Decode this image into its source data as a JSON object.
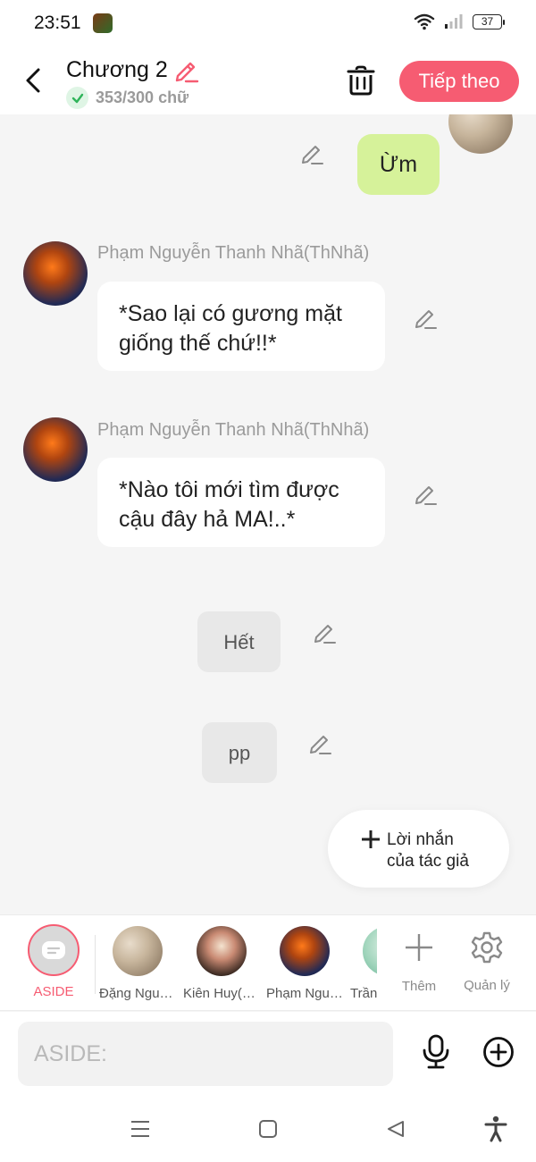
{
  "status_bar": {
    "time": "23:51",
    "battery": "37"
  },
  "header": {
    "title": "Chương 2",
    "word_count": "353/300 chữ",
    "next_button": "Tiếp theo"
  },
  "messages": [
    {
      "type": "self",
      "text": "Ừm"
    },
    {
      "type": "other",
      "sender": "Phạm Nguyễn Thanh Nhã(ThNhã)",
      "text": "*Sao lại có gương mặt giống thế chứ!!*"
    },
    {
      "type": "other",
      "sender": "Phạm Nguyễn Thanh Nhã(ThNhã)",
      "text": "*Nào tôi mới tìm được cậu đây hả MA!..*"
    },
    {
      "type": "aside",
      "text": "Hết"
    },
    {
      "type": "aside",
      "text": "pp"
    }
  ],
  "author_note": {
    "line1": "Lời nhắn",
    "line2": "của tác giả"
  },
  "characters": [
    {
      "label": "ASIDE",
      "icon": "aside-icon"
    },
    {
      "label": "Đặng Nguyễn"
    },
    {
      "label": "Kiên Huy(KiHuy)"
    },
    {
      "label": "Phạm Nguyễn"
    },
    {
      "label": "Trần"
    }
  ],
  "tools": {
    "add_label": "Thêm",
    "manage_label": "Quản lý"
  },
  "input": {
    "placeholder": "ASIDE:"
  },
  "colors": {
    "accent": "#f65c72",
    "self_bubble": "#d6f29a",
    "check": "#2fb45a"
  }
}
